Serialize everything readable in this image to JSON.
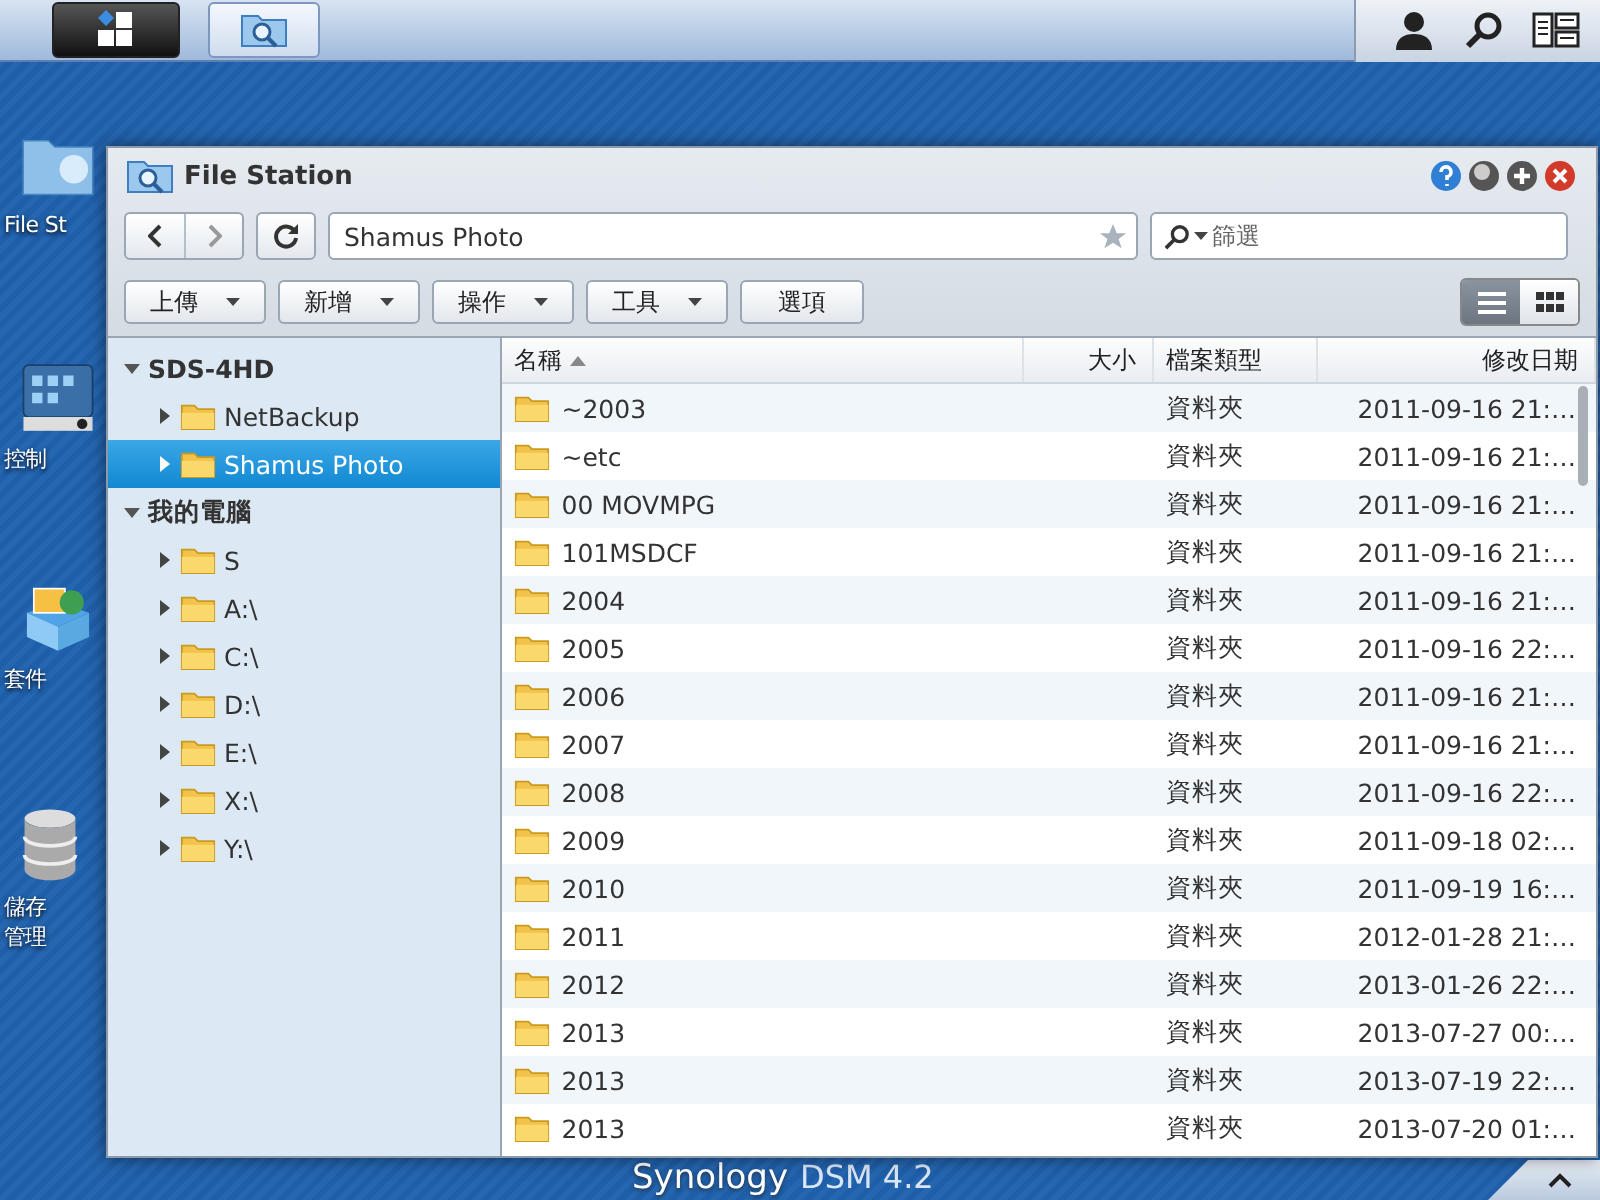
{
  "taskbar": {
    "apps": [
      {
        "kind": "main-menu",
        "selected": true
      },
      {
        "kind": "file-station",
        "selected": false
      }
    ],
    "tools": [
      {
        "kind": "user"
      },
      {
        "kind": "search"
      },
      {
        "kind": "widgets"
      }
    ]
  },
  "desktop_icons": [
    {
      "kind": "folder",
      "lines": [
        "File St"
      ]
    },
    {
      "kind": "control",
      "lines": [
        "控制"
      ]
    },
    {
      "kind": "package",
      "lines": [
        "套件"
      ]
    },
    {
      "kind": "storage",
      "lines": [
        "儲存",
        "管理"
      ]
    }
  ],
  "window": {
    "title": "File Station",
    "path": "Shamus Photo",
    "filter": {
      "placeholder": "篩選"
    },
    "buttons": [
      {
        "label": "上傳",
        "dropdown": true
      },
      {
        "label": "新增",
        "dropdown": true
      },
      {
        "label": "操作",
        "dropdown": true
      },
      {
        "label": "工具",
        "dropdown": true
      },
      {
        "label": "選項",
        "dropdown": false
      }
    ],
    "view_modes": [
      {
        "kind": "list",
        "selected": true
      },
      {
        "kind": "grid",
        "selected": false
      }
    ],
    "tree": [
      {
        "label": "SDS-4HD",
        "expanded": true,
        "selected": false,
        "children": [
          {
            "label": "NetBackup",
            "expanded": false,
            "selected": false
          },
          {
            "label": "Shamus Photo",
            "expanded": false,
            "selected": true
          }
        ]
      },
      {
        "label": "我的電腦",
        "expanded": true,
        "selected": false,
        "children": [
          {
            "label": "S",
            "expanded": false,
            "selected": false
          },
          {
            "label": "A:\\",
            "expanded": false,
            "selected": false
          },
          {
            "label": "C:\\",
            "expanded": false,
            "selected": false
          },
          {
            "label": "D:\\",
            "expanded": false,
            "selected": false
          },
          {
            "label": "E:\\",
            "expanded": false,
            "selected": false
          },
          {
            "label": "X:\\",
            "expanded": false,
            "selected": false
          },
          {
            "label": "Y:\\",
            "expanded": false,
            "selected": false
          }
        ]
      }
    ],
    "columns": [
      {
        "label": "名稱",
        "sorted": true
      },
      {
        "label": "大小",
        "sorted": false
      },
      {
        "label": "檔案類型",
        "sorted": false
      },
      {
        "label": "修改日期",
        "sorted": false
      }
    ],
    "rows": [
      {
        "name": "~2003",
        "type": "資料夾",
        "modified": "2011-09-16 21:…"
      },
      {
        "name": "~etc",
        "type": "資料夾",
        "modified": "2011-09-16 21:…"
      },
      {
        "name": "00 MOVMPG",
        "type": "資料夾",
        "modified": "2011-09-16 21:…"
      },
      {
        "name": "101MSDCF",
        "type": "資料夾",
        "modified": "2011-09-16 21:…"
      },
      {
        "name": "2004",
        "type": "資料夾",
        "modified": "2011-09-16 21:…"
      },
      {
        "name": "2005",
        "type": "資料夾",
        "modified": "2011-09-16 22:…"
      },
      {
        "name": "2006",
        "type": "資料夾",
        "modified": "2011-09-16 21:…"
      },
      {
        "name": "2007",
        "type": "資料夾",
        "modified": "2011-09-16 21:…"
      },
      {
        "name": "2008",
        "type": "資料夾",
        "modified": "2011-09-16 22:…"
      },
      {
        "name": "2009",
        "type": "資料夾",
        "modified": "2011-09-18 02:…"
      },
      {
        "name": "2010",
        "type": "資料夾",
        "modified": "2011-09-19 16:…"
      },
      {
        "name": "2011",
        "type": "資料夾",
        "modified": "2012-01-28 21:…"
      },
      {
        "name": "2012",
        "type": "資料夾",
        "modified": "2013-01-26 22:…"
      },
      {
        "name": "2013",
        "type": "資料夾",
        "modified": "2013-07-27 00:…"
      },
      {
        "name": "2013",
        "type": "資料夾",
        "modified": "2013-07-19 22:…"
      },
      {
        "name": "2013",
        "type": "資料夾",
        "modified": "2013-07-20 01:…"
      }
    ]
  },
  "footer": {
    "brand": "Synology",
    "product": "DSM 4.2"
  }
}
